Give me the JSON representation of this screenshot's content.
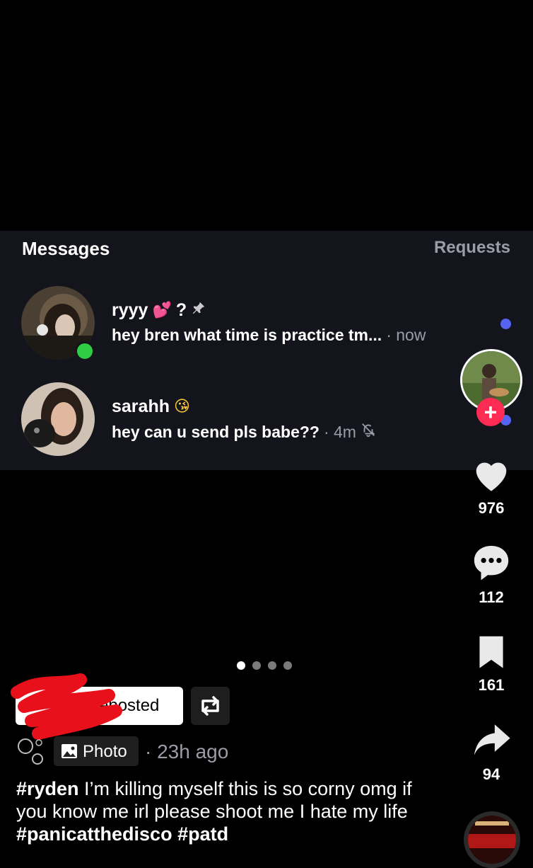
{
  "messages_panel": {
    "title": "Messages",
    "requests_label": "Requests",
    "conversations": [
      {
        "name": "ryyy",
        "name_emoji": "💕",
        "name_suffix": "?",
        "pinned": true,
        "preview": "hey bren what time is practice tm...",
        "time": "· now",
        "online": true,
        "unread": true
      },
      {
        "name": "sarahh",
        "name_emoji": "😘",
        "preview": "hey can u send pls babe??",
        "time": "· 4m",
        "muted": true,
        "unread": true
      }
    ]
  },
  "rail": {
    "likes": "976",
    "comments": "112",
    "saves": "161",
    "shares": "94",
    "follow_symbol": "+"
  },
  "pager": {
    "count": 4,
    "active": 0
  },
  "post": {
    "repost_label": "eposted",
    "photo_label": "Photo",
    "time_ago": "· 23h ago",
    "caption_tag1": "#ryden",
    "caption_text": " I’m killing myself this is so corny omg if you know me irl please shoot me I hate my life ",
    "caption_tag2": "#panicatthedisco",
    "caption_tag3": "#patd"
  },
  "colors": {
    "card_bg": "#14151c",
    "unread_dot": "#5564f2",
    "online_dot": "#2fcc44",
    "follow_button": "#fe2c55",
    "muted_text": "#9b9ca5"
  }
}
